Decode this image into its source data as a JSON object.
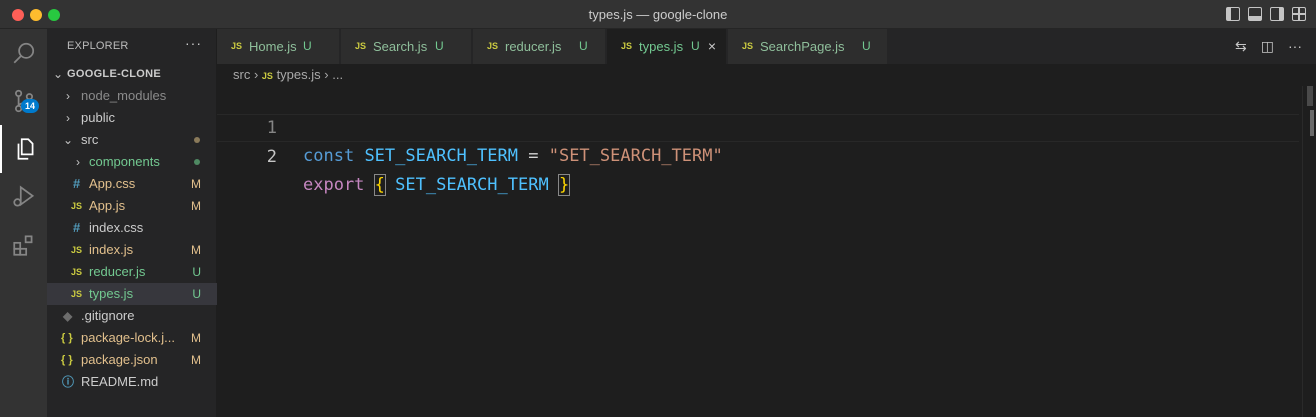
{
  "window": {
    "title": "types.js — google-clone"
  },
  "activity_bar": {
    "items": [
      {
        "icon": "search-icon"
      },
      {
        "icon": "source-control-icon",
        "badge": "14"
      },
      {
        "icon": "explorer-icon"
      },
      {
        "icon": "run-debug-icon"
      },
      {
        "icon": "extensions-icon"
      }
    ]
  },
  "sidebar": {
    "header": "EXPLORER",
    "more": "···",
    "root": "GOOGLE-CLONE",
    "items": [
      {
        "name": "node_modules",
        "type": "folder",
        "status": ""
      },
      {
        "name": "public",
        "type": "folder",
        "status": ""
      },
      {
        "name": "src",
        "type": "folder-open",
        "status": ""
      },
      {
        "name": "components",
        "type": "folder",
        "status": ""
      },
      {
        "name": "App.css",
        "type": "css",
        "status": "M"
      },
      {
        "name": "App.js",
        "type": "js",
        "status": "M"
      },
      {
        "name": "index.css",
        "type": "css",
        "status": ""
      },
      {
        "name": "index.js",
        "type": "js",
        "status": "M"
      },
      {
        "name": "reducer.js",
        "type": "js",
        "status": "U"
      },
      {
        "name": "types.js",
        "type": "js",
        "status": "U"
      },
      {
        "name": ".gitignore",
        "type": "git",
        "status": ""
      },
      {
        "name": "package-lock.j...",
        "type": "json",
        "status": "M"
      },
      {
        "name": "package.json",
        "type": "json",
        "status": "M"
      },
      {
        "name": "README.md",
        "type": "info",
        "status": ""
      }
    ]
  },
  "tabs": [
    {
      "label": "Home.js",
      "status": "U",
      "active": false
    },
    {
      "label": "Search.js",
      "status": "U",
      "active": false
    },
    {
      "label": "reducer.js",
      "status": "U",
      "active": false
    },
    {
      "label": "types.js",
      "status": "U",
      "active": true
    },
    {
      "label": "SearchPage.js",
      "status": "U",
      "active": false
    }
  ],
  "tab_icon_text": "JS",
  "tab_close": "×",
  "breadcrumb": {
    "folder": "src",
    "file": "types.js",
    "more": "..."
  },
  "editor": {
    "lines": [
      {
        "number": "1",
        "tokens": {
          "k": "const",
          "name": "SET_SEARCH_TERM",
          "eq": "=",
          "str": "\"SET_SEARCH_TERM\""
        }
      },
      {
        "number": "2",
        "tokens": {
          "k": "export",
          "open": "{",
          "name": "SET_SEARCH_TERM",
          "close": "}"
        }
      }
    ]
  },
  "colors": {
    "accent": "#007acc",
    "modified": "#e2c08d",
    "untracked": "#73c991",
    "js_icon": "#cbcb41",
    "css_icon": "#519aba"
  }
}
